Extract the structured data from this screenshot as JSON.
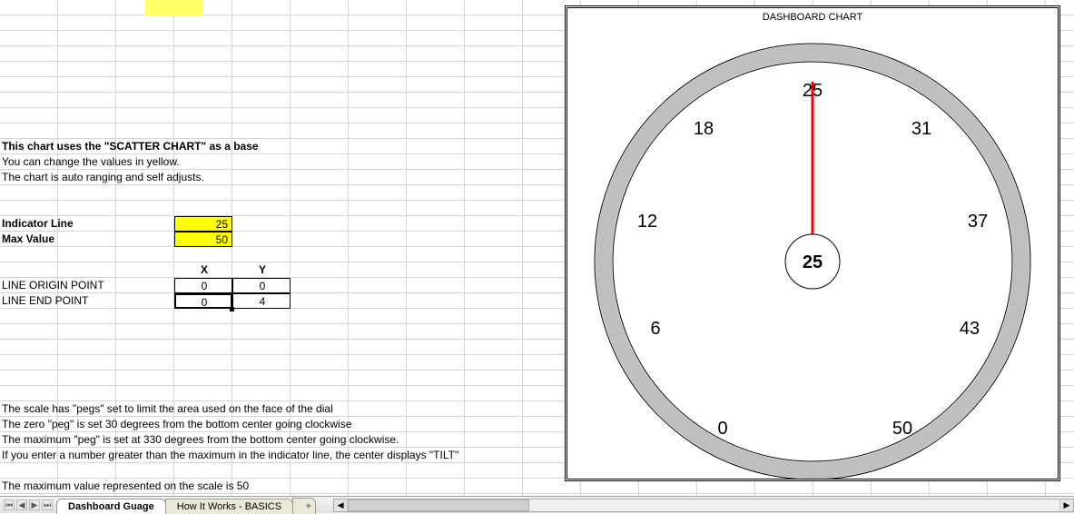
{
  "heading": {
    "line1": "This chart uses the \"SCATTER CHART\" as a base",
    "line2": "You can change the values in yellow.",
    "line3": "The chart is auto ranging and self adjusts."
  },
  "inputs": {
    "indicator_label": "Indicator Line",
    "indicator_value": "25",
    "max_label": "Max Value",
    "max_value": "50"
  },
  "table": {
    "headX": "X",
    "headY": "Y",
    "row1_label": "LINE ORIGIN POINT",
    "row1_x": "0",
    "row1_y": "0",
    "row2_label": "LINE END POINT",
    "row2_x": "0",
    "row2_y": "4"
  },
  "notes": {
    "n1": "The scale has \"pegs\" set to limit the area used on the face of the dial",
    "n2": "The zero \"peg\" is set 30 degrees from the bottom center going clockwise",
    "n3": "The maximum \"peg\" is set at 330 degrees from the bottom center going clockwise.",
    "n4": "If you enter a number greater than the maximum in the indicator line, the center displays \"TILT\"",
    "n5": "The maximum value represented on the scale is 50"
  },
  "chart": {
    "title": "DASHBOARD CHART",
    "center_value": "25",
    "ticks": {
      "t0": "0",
      "t1": "6",
      "t2": "12",
      "t3": "18",
      "t4": "25",
      "t5": "31",
      "t6": "37",
      "t7": "43",
      "t8": "50"
    }
  },
  "tabs": {
    "t1": "Dashboard Guage",
    "t2": "How It Works - BASICS"
  },
  "chart_data": {
    "type": "gauge",
    "title": "DASHBOARD CHART",
    "min": 0,
    "max": 50,
    "start_angle_deg": 210,
    "end_angle_deg": -30,
    "scale_ticks": [
      0,
      6,
      12,
      18,
      25,
      31,
      37,
      43,
      50
    ],
    "indicator_value": 25,
    "needle_points": {
      "x": [
        0,
        0
      ],
      "y": [
        0,
        4
      ]
    },
    "needle_color": "#ff0000"
  }
}
